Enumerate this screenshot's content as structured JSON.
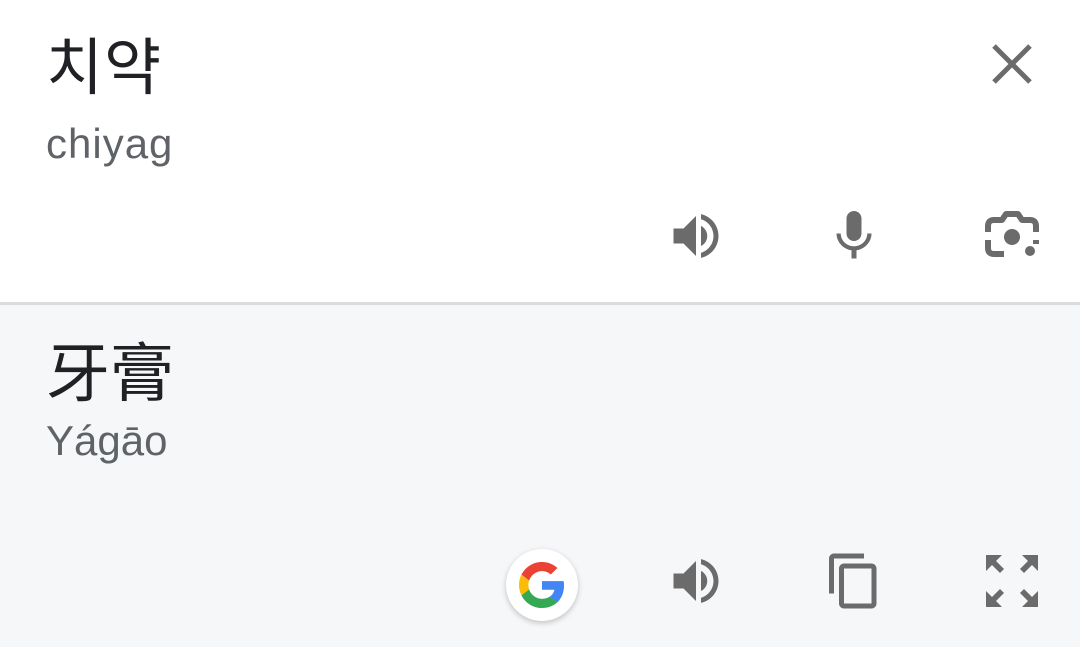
{
  "source": {
    "text": "치약",
    "transliteration": "chiyag",
    "actions": [
      "close-icon",
      "speaker-icon",
      "microphone-icon",
      "camera-icon"
    ]
  },
  "target": {
    "text": "牙膏",
    "transliteration": "Yágāo",
    "actions": [
      "google-icon",
      "speaker-icon",
      "copy-icon",
      "fullscreen-icon"
    ]
  },
  "colors": {
    "icon": "#6b6b6b",
    "text": "#202124",
    "secondary_text": "#5f6368",
    "source_bg": "#ffffff",
    "target_bg": "#f6f7f9",
    "divider": "#dadce0",
    "google_blue": "#4285F4",
    "google_red": "#EA4335",
    "google_yellow": "#FBBC05",
    "google_green": "#34A853"
  }
}
